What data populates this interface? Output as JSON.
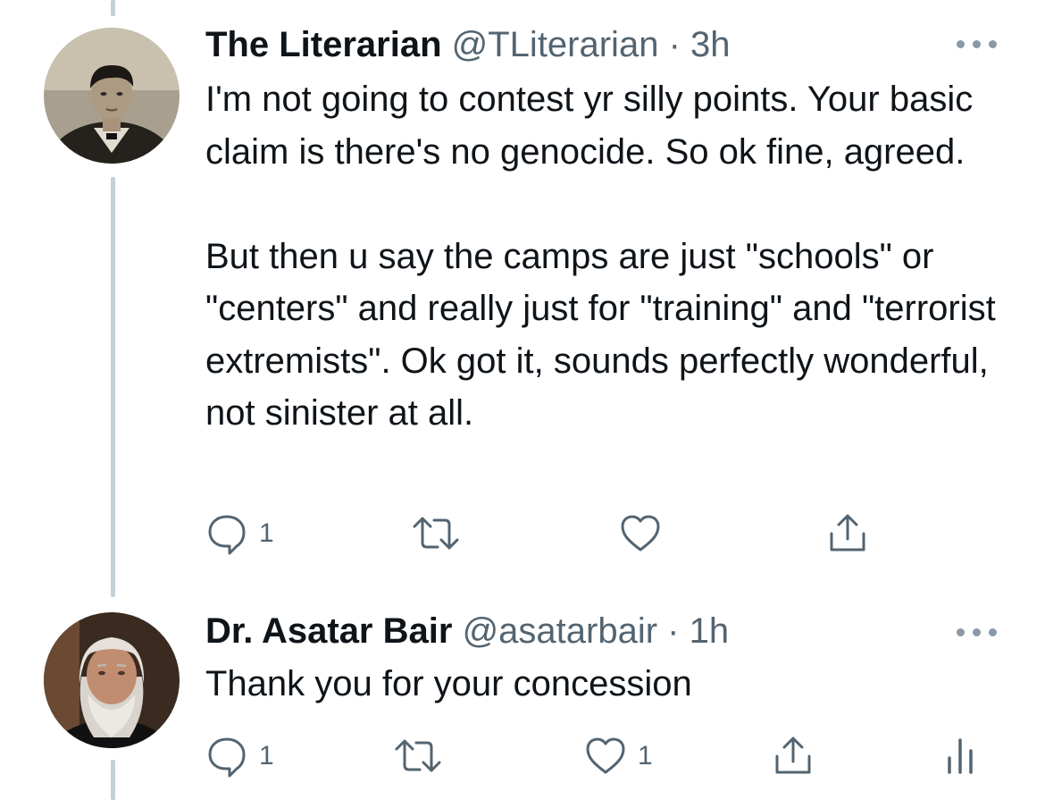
{
  "tweets": [
    {
      "display_name": "The Literarian",
      "handle": "@TLiterarian",
      "separator": "·",
      "time": "3h",
      "text_paragraphs": [
        "I'm not going to contest yr silly points. Your basic claim is there's no genocide. So ok fine, agreed.",
        "But then u say the camps are just \"schools\" or \"centers\" and really just for \"training\" and \"terrorist extremists\". Ok got it, sounds perfectly wonderful, not sinister at all."
      ],
      "reply_count": "1",
      "retweet_count": "",
      "like_count": "",
      "avatar_icon": "vintage-portrait-avatar"
    },
    {
      "display_name": "Dr. Asatar Bair",
      "handle": "@asatarbair",
      "separator": "·",
      "time": "1h",
      "text_paragraphs": [
        "Thank you for your concession"
      ],
      "reply_count": "1",
      "retweet_count": "",
      "like_count": "1",
      "avatar_icon": "bearded-man-avatar"
    }
  ],
  "icons": {
    "reply": "reply-icon",
    "retweet": "retweet-icon",
    "like": "heart-icon",
    "share": "share-icon",
    "analytics": "analytics-icon",
    "more": "more-options-icon"
  },
  "colors": {
    "text": "#0f1419",
    "secondary": "#536471",
    "thread_line": "#c4cfd6",
    "icon": "#536471"
  }
}
